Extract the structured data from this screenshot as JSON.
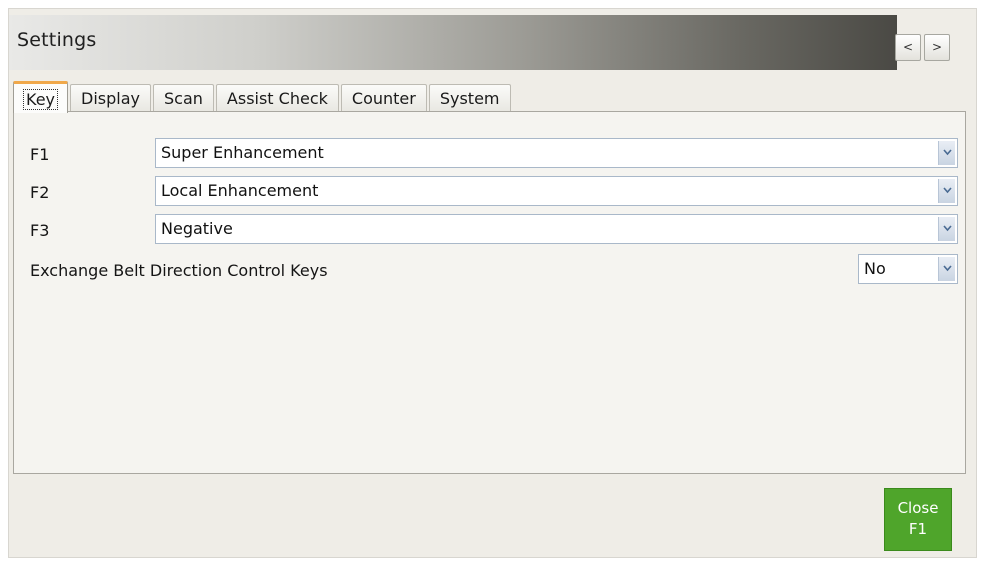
{
  "window": {
    "title": "Settings",
    "prev_label": "<",
    "next_label": ">"
  },
  "tabs": [
    {
      "label": "Key",
      "active": true
    },
    {
      "label": "Display"
    },
    {
      "label": "Scan"
    },
    {
      "label": "Assist Check"
    },
    {
      "label": "Counter"
    },
    {
      "label": "System"
    }
  ],
  "key_settings": {
    "f1": {
      "label": "F1",
      "value": "Super Enhancement"
    },
    "f2": {
      "label": "F2",
      "value": "Local Enhancement"
    },
    "f3": {
      "label": "F3",
      "value": "Negative"
    },
    "exchange_belt": {
      "label": "Exchange Belt Direction Control Keys",
      "value": "No"
    }
  },
  "close_button": {
    "line1": "Close",
    "line2": "F1",
    "color": "#4fa52b"
  },
  "icons": {
    "dropdown": "chevron-down-icon"
  }
}
